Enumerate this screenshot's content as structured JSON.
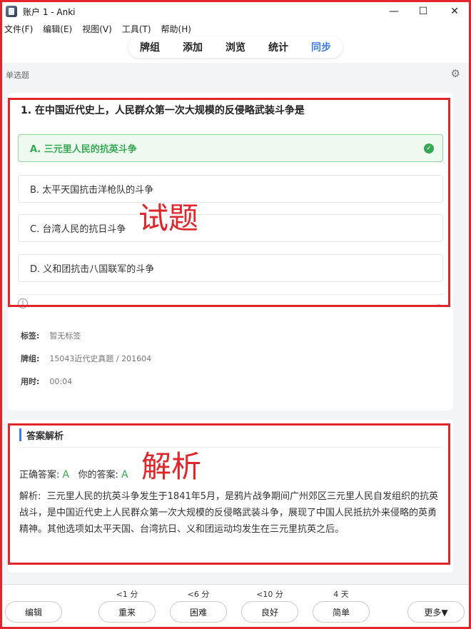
{
  "window": {
    "title": "账户 1 - Anki",
    "minimize": "—",
    "maximize": "☐",
    "close": "✕"
  },
  "menu": [
    "文件(F)",
    "编辑(E)",
    "视图(V)",
    "工具(T)",
    "帮助(H)"
  ],
  "toolbar": [
    "牌组",
    "添加",
    "浏览",
    "统计",
    "同步"
  ],
  "toolbar_active": "同步",
  "question_type": "单选题",
  "question": "1. 在中国近代史上，人民群众第一次大规模的反侵略武装斗争是",
  "options": [
    "A. 三元里人民的抗英斗争",
    "B. 太平天国抗击洋枪队的斗争",
    "C. 台湾人民的抗日斗争",
    "D. 义和团抗击八国联军的斗争"
  ],
  "correct_option_index": 0,
  "annotation_question": "试题",
  "annotation_analysis": "解析",
  "meta": {
    "tags_label": "标签:",
    "tags_value": "暂无标签",
    "deck_label": "牌组:",
    "deck_value": "15043近代史真题 / 201604",
    "time_label": "用时:",
    "time_value": "00:04"
  },
  "analysis": {
    "heading": "答案解析",
    "correct_label": "正确答案:",
    "correct_value": "A",
    "your_label": "你的答案:",
    "your_value": "A",
    "explanation_label": "解析:",
    "explanation": "三元里人民的抗英斗争发生于1841年5月，是鸦片战争期间广州郊区三元里人民自发组织的抗英战斗，是中国近代史上人民群众第一次大规模的反侵略武装斗争，展现了中国人民抵抗外来侵略的英勇精神。其他选项如太平天国、台湾抗日、义和团运动均发生在三元里抗英之后。"
  },
  "bottom": {
    "edit": "编辑",
    "more": "更多▼",
    "answers": [
      {
        "time": "<1 分",
        "label": "重来"
      },
      {
        "time": "<6 分",
        "label": "困难"
      },
      {
        "time": "<10 分",
        "label": "良好"
      },
      {
        "time": "4 天",
        "label": "简单"
      }
    ]
  },
  "colors": {
    "accent": "#3e7be0",
    "correct": "#35a852",
    "annotation": "#e0252b"
  }
}
